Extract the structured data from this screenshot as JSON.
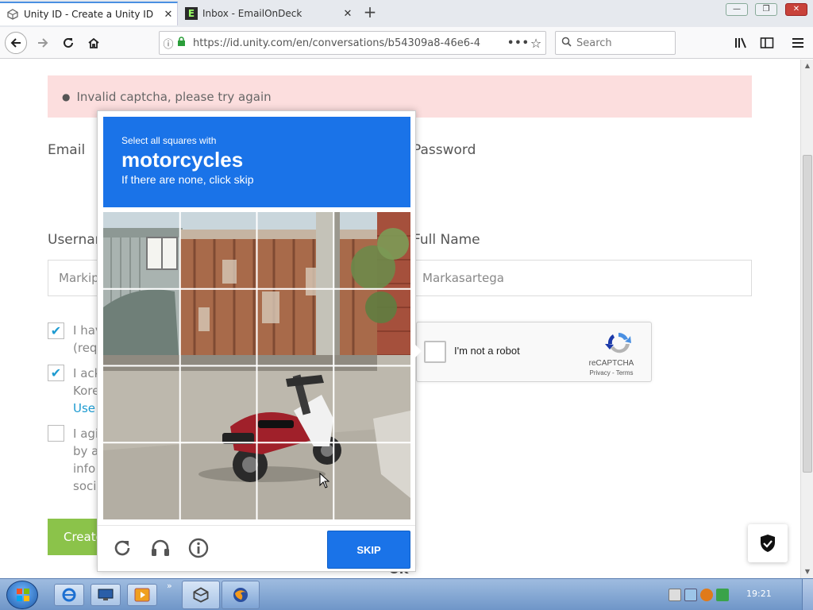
{
  "browser": {
    "tabs": [
      {
        "title": "Unity ID - Create a Unity ID",
        "active": true,
        "favicon": "unity-cube-icon"
      },
      {
        "title": "Inbox - EmailOnDeck",
        "active": false,
        "favicon": "emailondeck-e-icon",
        "favicon_text": "E"
      }
    ],
    "new_tab_label": "+",
    "url": "https://id.unity.com/en/conversations/b54309a8-46e6-4",
    "search_placeholder": "Search",
    "dots_label": "•••"
  },
  "page": {
    "alert_text": "Invalid captcha, please try again",
    "email_label": "Email",
    "password_label": "Password",
    "username_label": "Usernam",
    "username_value": "Markip",
    "fullname_label": "Full Name",
    "fullname_value": "Markasartega",
    "checkboxes": [
      {
        "checked": true,
        "lines": [
          "I hav",
          "(req"
        ]
      },
      {
        "checked": true,
        "lines": [
          "I ack",
          "Kore"
        ],
        "link": "Use"
      },
      {
        "checked": false,
        "lines": [
          "I agi",
          "by a",
          "info",
          "soci"
        ]
      }
    ],
    "create_button_label": "Create",
    "ok_peek": "OK"
  },
  "recaptcha": {
    "checkbox_label": "I'm not a robot",
    "brand": "reCAPTCHA",
    "privacy": "Privacy",
    "separator": " - ",
    "terms": "Terms"
  },
  "challenge": {
    "instruction": "Select all squares with",
    "target": "motorcycles",
    "hint": "If there are none, click skip",
    "skip_label": "SKIP",
    "grid_size": 4
  },
  "taskbar": {
    "clock": "19:21"
  },
  "colors": {
    "challenge_header": "#1a73e8",
    "alert_bg": "#fcdede",
    "create_button": "#8bc34a",
    "link": "#1d9bd1"
  }
}
